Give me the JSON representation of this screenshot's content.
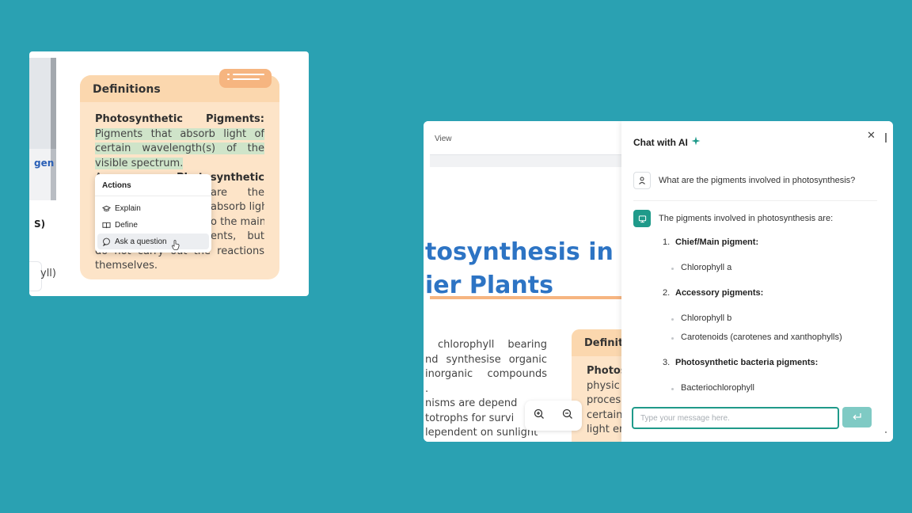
{
  "left_card": {
    "fragments": {
      "gen": "gen",
      "s": "S)",
      "yll": "yll)"
    },
    "definitions_title": "Definitions",
    "def_lines": [
      {
        "bold_a": "Photosynthetic",
        "bold_b": "Pigments:"
      },
      "Pigments that absorb light of",
      "certain wavelength(s) of the",
      "visible spectrum.",
      {
        "plain": "A",
        "bold": "Photosynthetic"
      },
      "are the",
      "absorb light",
      "o the main",
      "ents, but",
      "do not carry out the reactions",
      "themselves."
    ],
    "actions": {
      "title": "Actions",
      "items": [
        {
          "label": "Explain",
          "icon": "graduation-cap-icon"
        },
        {
          "label": "Define",
          "icon": "book-icon"
        },
        {
          "label": "Ask a question",
          "icon": "chat-bubble-icon"
        }
      ]
    }
  },
  "pdf_viewer": {
    "view_label": "View",
    "title_line1": "tosynthesis in",
    "title_line2": "ier Plants",
    "text_lines": [
      "chlorophyll bearing",
      "nd synthesise organic",
      "inorganic compounds",
      ".",
      "nisms are depend",
      "totrophs for survi",
      "lependent on sunlight"
    ],
    "def_head": "Definit",
    "def_lines": [
      "Photos",
      "physic",
      "proces",
      "certain",
      "light en"
    ]
  },
  "chat": {
    "title": "Chat with AI",
    "user_message": "What are the pigments involved in photosynthesis?",
    "ai_intro": "The pigments involved in photosynthesis are:",
    "list": [
      {
        "num": "1.",
        "label": "Chief/Main pigment:",
        "items": [
          "Chlorophyll a"
        ]
      },
      {
        "num": "2.",
        "label": "Accessory pigments:",
        "items": [
          "Chlorophyll b",
          "Carotenoids (carotenes and xanthophylls)"
        ]
      },
      {
        "num": "3.",
        "label": "Photosynthetic bacteria pigments:",
        "items": [
          "Bacteriochlorophyll"
        ]
      }
    ],
    "input_placeholder": "Type your message here.",
    "accent_color": "#1f9a8a"
  }
}
